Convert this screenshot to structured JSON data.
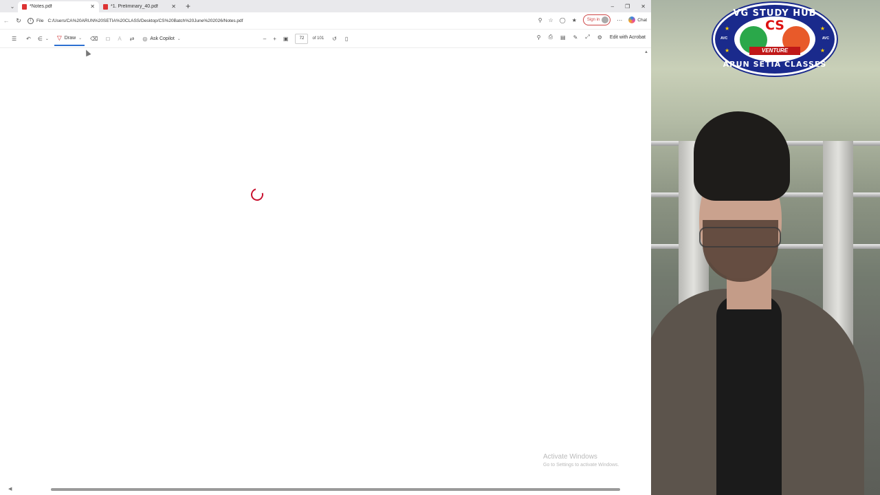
{
  "browser": {
    "tabs": [
      {
        "label": "*Notes.pdf",
        "active": true
      },
      {
        "label": "*1. Preliminary_40.pdf",
        "active": false
      }
    ],
    "url_scheme": "File",
    "url": "C:/Users/CA%20ARUN%20SETIA%20CLASS/Desktop/CS%20Batch%20June%202026/Notes.pdf",
    "sign_in_label": "Sign in",
    "chat_label": "Chat"
  },
  "pdf_toolbar": {
    "draw_label": "Draw",
    "ask_copilot_label": "Ask Copilot",
    "page_number": "72",
    "page_total": "of 101",
    "edit_with_acrobat_label": "Edit with Acrobat"
  },
  "document": {
    "loading": true,
    "spinner_color": "#c8102e"
  },
  "watermark": {
    "line1": "Activate Windows",
    "line2": "Go to Settings to activate Windows."
  },
  "logo": {
    "top_text": "VG STUDY HUB",
    "center_text": "CS",
    "ribbon_text": "VENTURE",
    "bottom_text": "ARUN SETIA CLASSES",
    "side_text": "AVC"
  }
}
